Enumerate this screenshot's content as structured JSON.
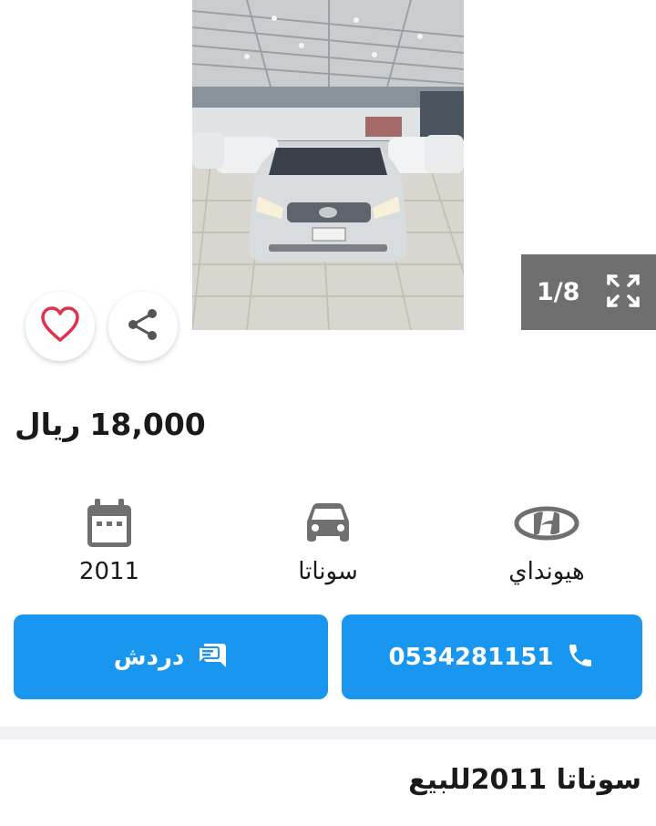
{
  "gallery": {
    "counter": "1/8",
    "icons": {
      "prev": "chevron-left-icon",
      "next": "chevron-right-icon",
      "expand": "expand-icon",
      "favorite": "heart-icon",
      "share": "share-icon"
    }
  },
  "price": {
    "value": "18,000",
    "currency": "ريال"
  },
  "specs": {
    "make": "هيونداي",
    "model": "سوناتا",
    "year": "2011",
    "icons": {
      "make": "hyundai-logo-icon",
      "model": "car-icon",
      "year": "calendar-icon"
    }
  },
  "actions": {
    "call_label": "0534281151",
    "chat_label": "دردش",
    "icons": {
      "call": "phone-icon",
      "chat": "chat-icon"
    }
  },
  "listing": {
    "title": "سوناتا 2011للبيع"
  },
  "colors": {
    "accent": "#1996f0",
    "favorite": "#e0334b",
    "counter_bg": "#6f6f6f",
    "icon_gray": "#6f6f6f"
  }
}
